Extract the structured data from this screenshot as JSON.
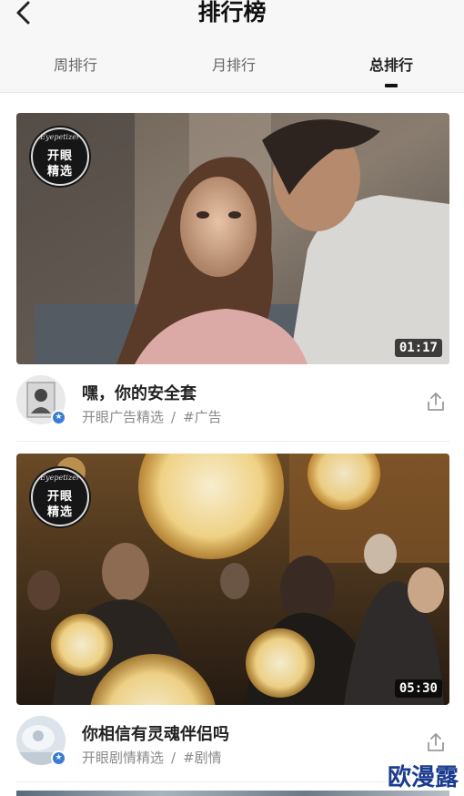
{
  "header": {
    "title": "排行榜"
  },
  "tabs": [
    {
      "label": "周排行",
      "active": false
    },
    {
      "label": "月排行",
      "active": false
    },
    {
      "label": "总排行",
      "active": true
    }
  ],
  "badge": {
    "script": "Eyepetizer",
    "line1": "开眼",
    "line2": "精选"
  },
  "videos": [
    {
      "title": "嘿，你的安全套",
      "source": "开眼广告精选",
      "separator": "/",
      "tag": "#广告",
      "duration": "01:17"
    },
    {
      "title": "你相信有灵魂伴侣吗",
      "source": "开眼剧情精选",
      "separator": "/",
      "tag": "#剧情",
      "duration": "05:30"
    }
  ],
  "watermark": "欧漫露",
  "icons": {
    "back": "chevron-left-icon",
    "share": "share-icon",
    "verified": "star-icon"
  },
  "colors": {
    "header_bg": "#f7f7f7",
    "verified": "#3a7bd5",
    "watermark": "#1b3c8f"
  }
}
